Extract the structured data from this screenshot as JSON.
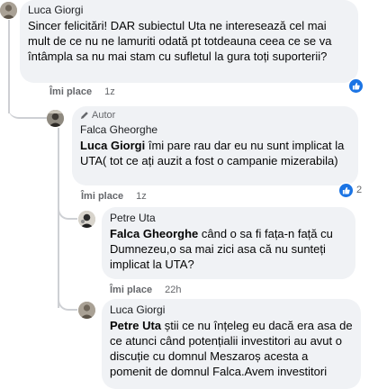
{
  "comments": [
    {
      "author": "Luca Giorgi",
      "text": "Sincer felicitări! DAR subiectul Uta ne interesează cel mai mult de ce nu ne lamuriti odată pt totdeauna ceea ce se va întâmpla sa nu mai stam cu sufletul la gura toți suporterii?",
      "like_label": "Îmi place",
      "time": "1z",
      "reaction_count": "",
      "avatar_icon": "user-avatar-photo"
    },
    {
      "badge": "Autor",
      "author": "Falca Gheorghe",
      "mention": "Luca Giorgi",
      "text": "îmi pare rau dar eu nu sunt implicat la UTA( tot ce ați auzit a fost o campanie mizerabila)",
      "like_label": "Îmi place",
      "time": "1z",
      "reaction_count": "2",
      "avatar_icon": "user-avatar-photo",
      "badge_icon": "pencil-icon"
    },
    {
      "author": "Petre Uta",
      "mention": "Falca Gheorghe",
      "text": "când o sa fi fața-n față cu Dumnezeu,o sa mai zici asa că nu sunteți implicat la UTA?",
      "like_label": "Îmi place",
      "time": "22h",
      "avatar_icon": "user-avatar-photo"
    },
    {
      "author": "Luca Giorgi",
      "mention": "Petre Uta",
      "text": "știi ce nu înțeleg eu dacă era asa de ce atunci când potențialii investitori au avut o discuție cu domnul Meszaroș acesta a pomenit de domnul Falca.Avem investitori",
      "avatar_icon": "user-avatar-photo"
    }
  ],
  "colors": {
    "bubble": "#f0f2f5",
    "like_badge": "#1b74e4",
    "muted_text": "#65676b"
  }
}
